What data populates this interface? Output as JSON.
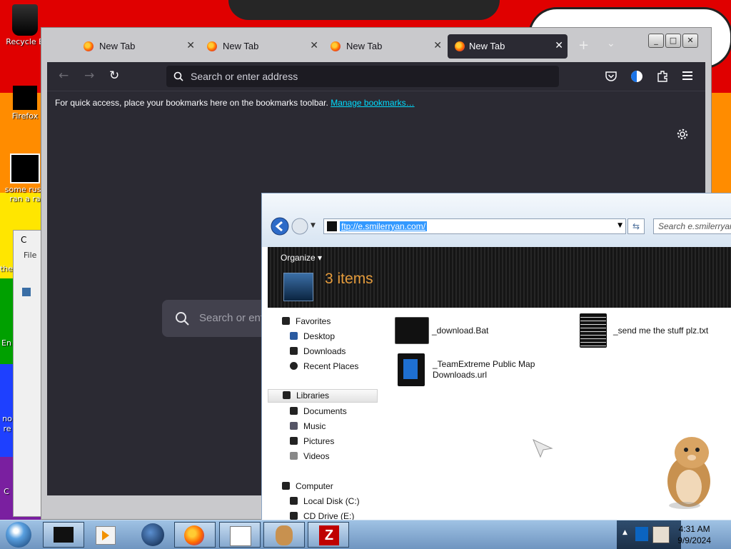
{
  "desktop": {
    "icons": [
      {
        "label": "Recycle B"
      },
      {
        "label": "Firefox"
      },
      {
        "label": "some russ"
      },
      {
        "label": "ran a ra"
      },
      {
        "label": "the"
      },
      {
        "label": "En"
      },
      {
        "label": "no"
      },
      {
        "label": "re"
      },
      {
        "label": "C"
      }
    ]
  },
  "browser": {
    "tabs": [
      {
        "label": "New Tab",
        "active": false
      },
      {
        "label": "New Tab",
        "active": false
      },
      {
        "label": "New Tab",
        "active": false
      },
      {
        "label": "New Tab",
        "active": true
      }
    ],
    "new_tab_glyph": "+",
    "tab_list_glyph": "⌄",
    "url_placeholder": "Search or enter address",
    "bookmarks_text": "For quick access, place your bookmarks here on the bookmarks toolbar.",
    "bookmarks_link": "Manage bookmarks…",
    "content_search_placeholder": "Search or ent"
  },
  "small_window": {
    "title": "C",
    "menu": "File"
  },
  "explorer": {
    "address": "ftp://e.smilerryan.com/",
    "search_placeholder": "Search e.smilerryan.com",
    "organize_label": "Organize",
    "items_count": "3 items",
    "nav": {
      "favorites": "Favorites",
      "desktop": "Desktop",
      "downloads": "Downloads",
      "recent": "Recent Places",
      "libraries": "Libraries",
      "documents": "Documents",
      "music": "Music",
      "pictures": "Pictures",
      "videos": "Videos",
      "computer": "Computer",
      "local_disk": "Local Disk (C:)",
      "cd_drive": "CD Drive (E:)"
    },
    "files": [
      {
        "name": "_download.Bat"
      },
      {
        "name": "_send me the stuff plz.txt"
      },
      {
        "name_line1": "_TeamExtreme Public Map",
        "name_line2": "Downloads.url"
      }
    ]
  },
  "taskbar": {
    "time": "4:31 AM",
    "date": "9/9/2024",
    "tray_arrow": "▲"
  },
  "colors": {
    "firefox_dark": "#2b2a33",
    "firefox_field": "#1c1b22",
    "link": "#00ddff",
    "items_count": "#e49b3c",
    "taskbar": "#9fc2e4"
  }
}
